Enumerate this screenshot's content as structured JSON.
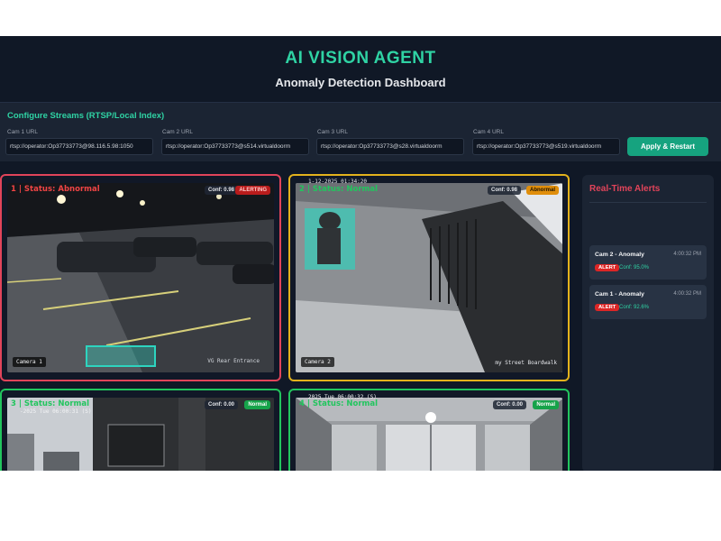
{
  "header": {
    "title": "AI VISION AGENT",
    "subtitle": "Anomaly Detection Dashboard"
  },
  "config": {
    "title": "Configure Streams (RTSP/Local Index)",
    "cams": [
      {
        "label": "Cam 1 URL",
        "value": "rtsp://operator:Op37733773@98.116.5.98:1050"
      },
      {
        "label": "Cam 2 URL",
        "value": "rtsp://operator:Op37733773@s514.virtualdoorm"
      },
      {
        "label": "Cam 3 URL",
        "value": "rtsp://operator:Op37733773@s28.virtualdoorm"
      },
      {
        "label": "Cam 4 URL",
        "value": "rtsp://operator:Op37733773@s519.virtualdoorm"
      }
    ],
    "apply_label": "Apply & Restart"
  },
  "tiles": [
    {
      "status": "1 | Status: Abnormal",
      "conf": "Conf: 0.98",
      "badge": "ALERTING",
      "tag": "Camera 1",
      "overlay": "VG Rear Entrance"
    },
    {
      "status": "2 | Status: Normal",
      "conf": "Conf: 0.98",
      "badge": "Abnormal",
      "tag": "Camera 2",
      "overlay": "my Street Boardwalk",
      "timestamp": "1-12-2025 01:34:20"
    },
    {
      "status": "3 | Status: Normal",
      "conf": "Conf: 0.00",
      "badge": "Normal",
      "timestamp": "-2025 Tue 06:00:31 (S)"
    },
    {
      "status": "4 | Status: Normal",
      "conf": "Conf: 0.00",
      "badge": "Normal",
      "timestamp": "2025 Tue 06:00:32 (S)"
    }
  ],
  "alerts": {
    "title": "Real-Time Alerts",
    "items": [
      {
        "name": "Cam 2 - Anomaly",
        "time": "4:00:32 PM",
        "badge": "ALERT",
        "conf": "Conf: 95.0%"
      },
      {
        "name": "Cam 1 - Anomaly",
        "time": "4:00:32 PM",
        "badge": "ALERT",
        "conf": "Conf: 92.6%"
      }
    ]
  },
  "colors": {
    "accent": "#2fd3a4",
    "alert": "#e1445a",
    "warning": "#e3b21c",
    "ok": "#22c55e",
    "background": "#101826",
    "panel": "#1b2433"
  }
}
